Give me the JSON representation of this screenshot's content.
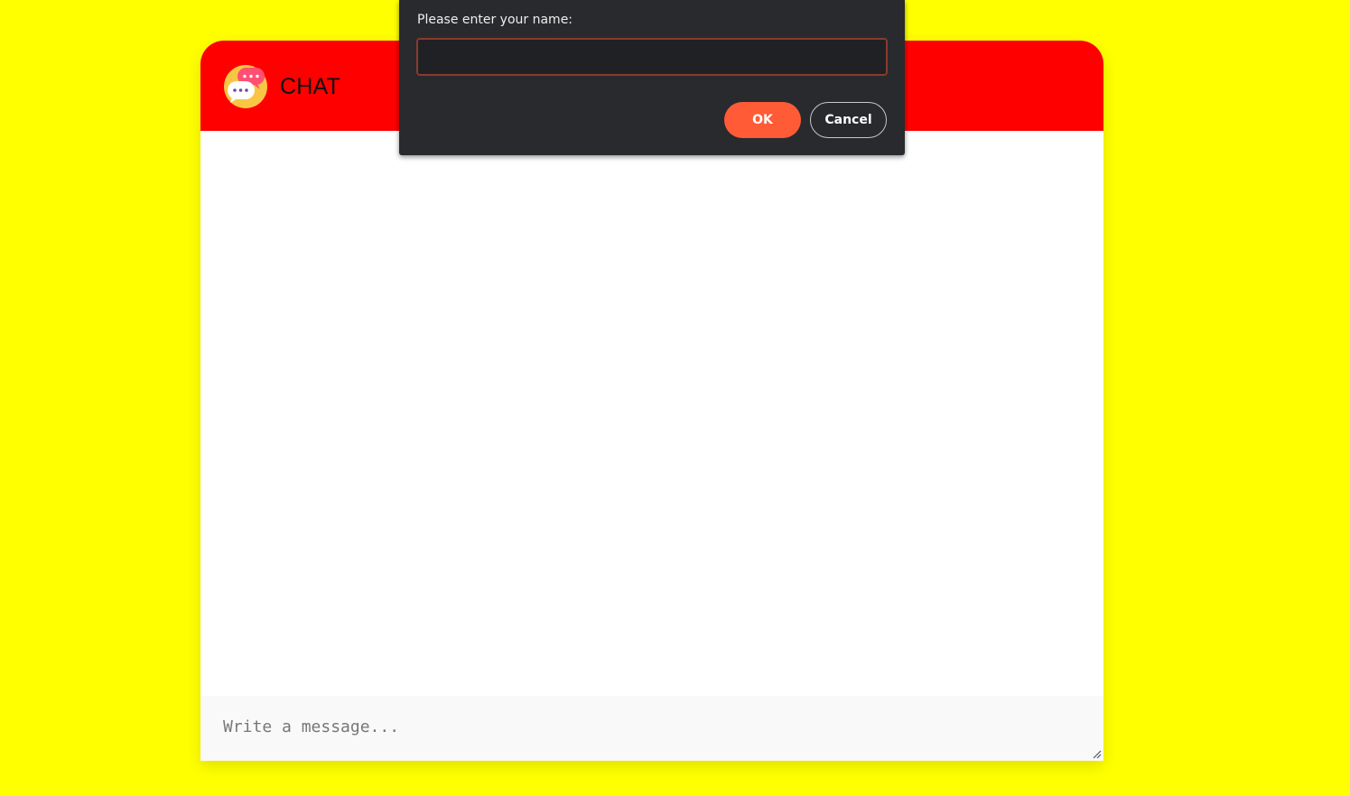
{
  "chat": {
    "title": "CHAT",
    "logo_icon": "chat-bubbles-icon",
    "message_placeholder": "Write a message..."
  },
  "dialog": {
    "label": "Please enter your name:",
    "input_value": "",
    "ok_label": "OK",
    "cancel_label": "Cancel"
  },
  "colors": {
    "page_background": "#ffff00",
    "header_background": "#ff0000",
    "dialog_background": "#292a2d",
    "ok_button": "#ff5b36"
  }
}
